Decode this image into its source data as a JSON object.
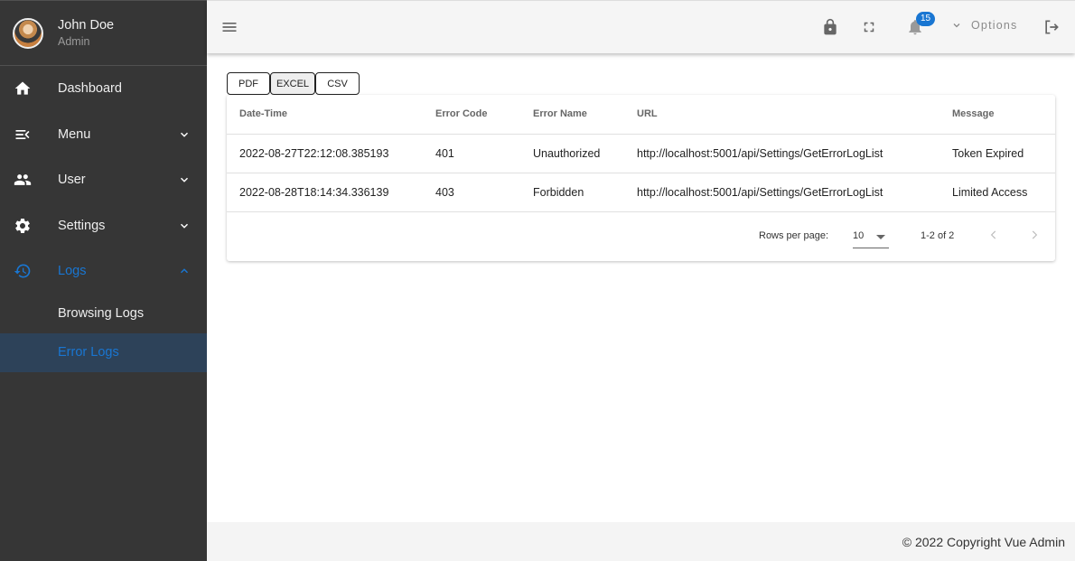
{
  "user": {
    "name": "John Doe",
    "role": "Admin"
  },
  "sidebar": {
    "items": [
      {
        "label": "Dashboard",
        "icon": "home-icon"
      },
      {
        "label": "Menu",
        "icon": "menu-open-icon"
      },
      {
        "label": "User",
        "icon": "users-icon"
      },
      {
        "label": "Settings",
        "icon": "gear-icon"
      },
      {
        "label": "Logs",
        "icon": "history-icon"
      }
    ],
    "logs_children": [
      {
        "label": "Browsing Logs"
      },
      {
        "label": "Error Logs"
      }
    ]
  },
  "topbar": {
    "notification_count": "15",
    "options_label": "Options"
  },
  "export": {
    "pdf": "PDF",
    "excel": "EXCEL",
    "csv": "CSV"
  },
  "table": {
    "headers": [
      "Date-Time",
      "Error Code",
      "Error Name",
      "URL",
      "Message"
    ],
    "rows": [
      [
        "2022-08-27T22:12:08.385193",
        "401",
        "Unauthorized",
        "http://localhost:5001/api/Settings/GetErrorLogList",
        "Token Expired"
      ],
      [
        "2022-08-28T18:14:34.336139",
        "403",
        "Forbidden",
        "http://localhost:5001/api/Settings/GetErrorLogList",
        "Limited Access"
      ]
    ]
  },
  "pagination": {
    "rows_per_page_label": "Rows per page:",
    "rows_per_page": "10",
    "range": "1-2 of 2"
  },
  "footer": {
    "copyright": "© 2022 Copyright Vue Admin"
  },
  "colors": {
    "accent": "#1976d2",
    "sidebar_bg": "#363636",
    "active_bg": "#2d4259"
  }
}
